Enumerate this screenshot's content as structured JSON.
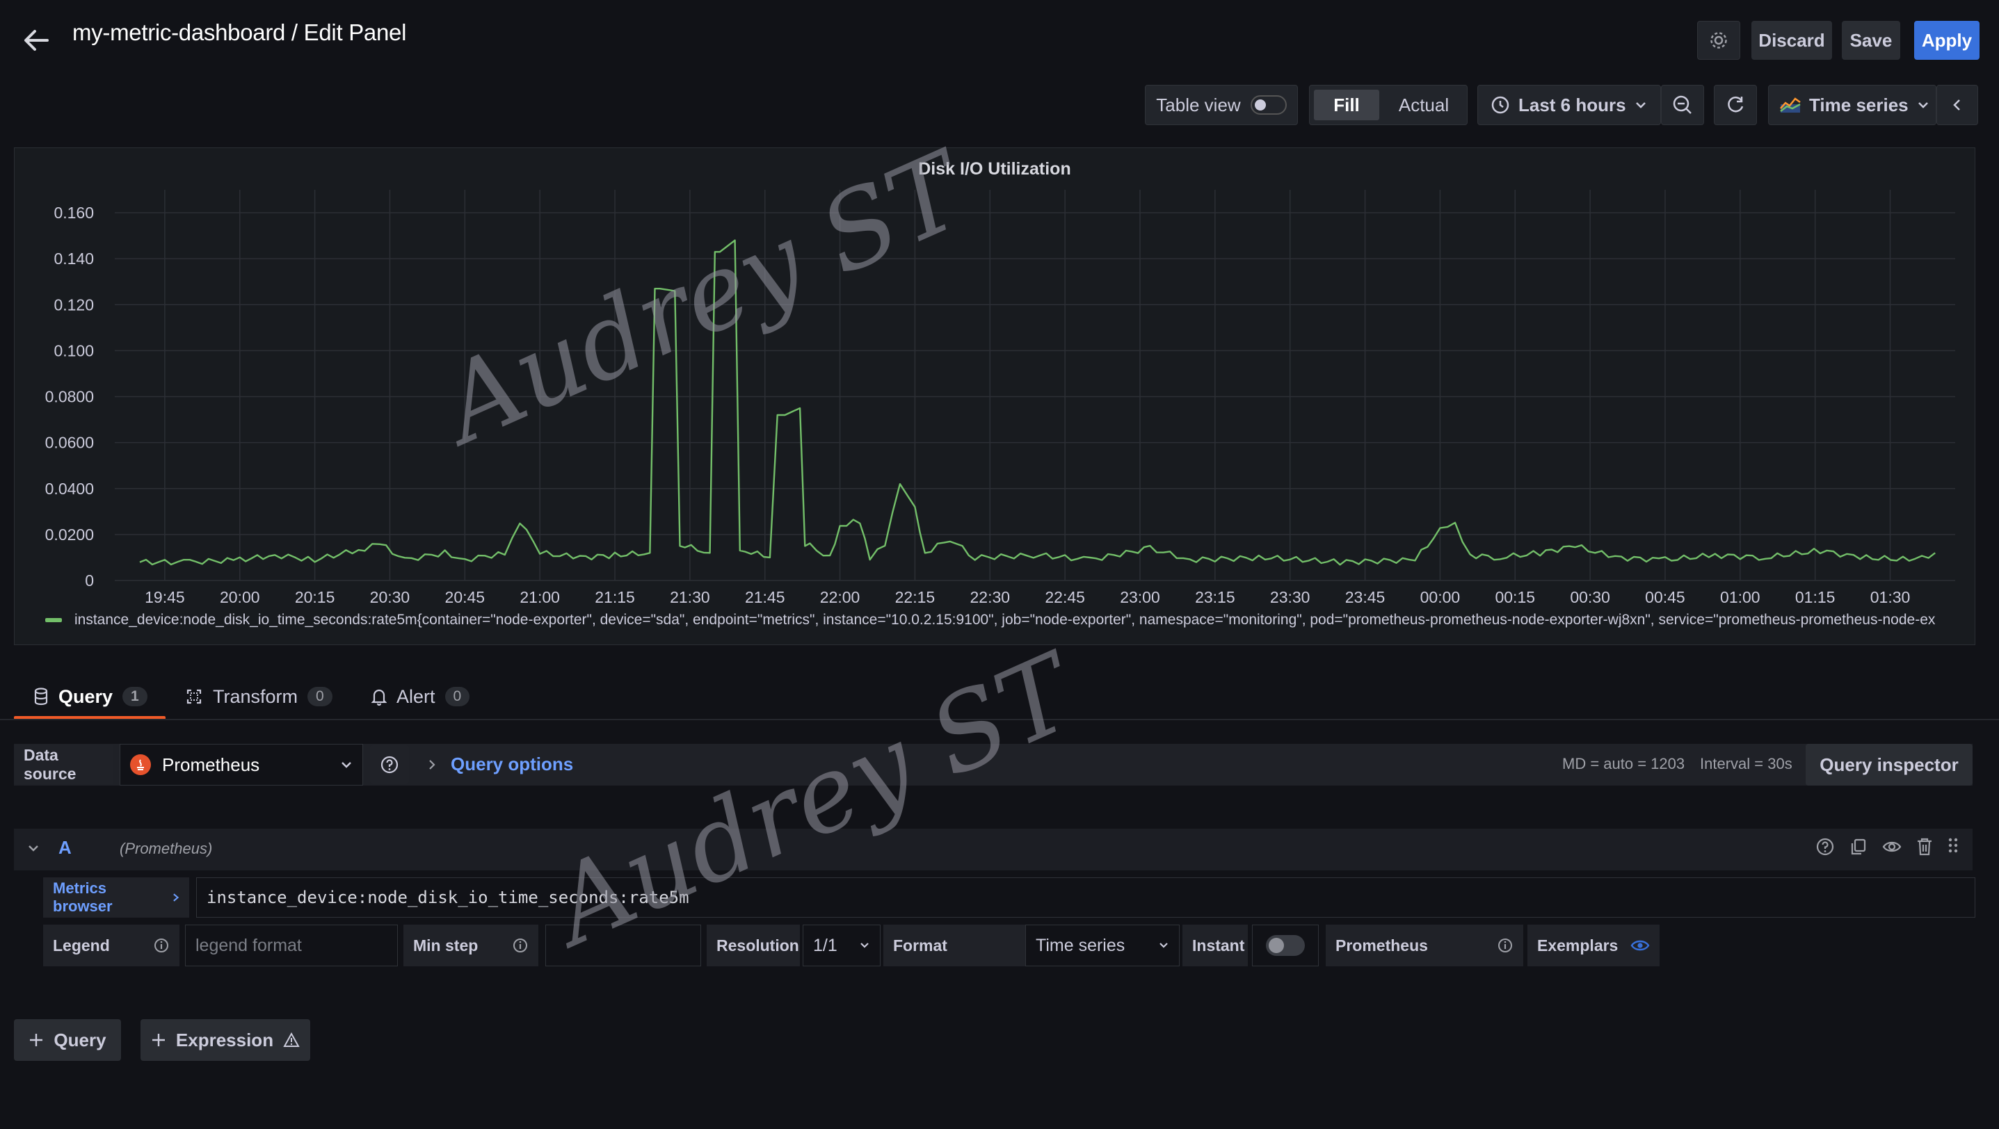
{
  "header": {
    "back_label": "←",
    "title": "my-metric-dashboard / Edit Panel",
    "discard_label": "Discard",
    "save_label": "Save",
    "apply_label": "Apply"
  },
  "toolbar": {
    "table_view_label": "Table view",
    "fill_label": "Fill",
    "actual_label": "Actual",
    "time_range_label": "Last 6 hours",
    "visualization_label": "Time series"
  },
  "panel": {
    "title": "Disk I/O Utilization",
    "legend_text": "instance_device:node_disk_io_time_seconds:rate5m{container=\"node-exporter\", device=\"sda\", endpoint=\"metrics\", instance=\"10.0.2.15:9100\", job=\"node-exporter\", namespace=\"monitoring\", pod=\"prometheus-prometheus-node-exporter-wj8xn\", service=\"prometheus-prometheus-node-ex",
    "series_color": "#73bf69"
  },
  "chart_data": {
    "type": "line",
    "title": "Disk I/O Utilization",
    "xlabel": "",
    "ylabel": "",
    "ylim": [
      0,
      0.17
    ],
    "y_ticks": [
      "0",
      "0.0200",
      "0.0400",
      "0.0600",
      "0.0800",
      "0.100",
      "0.120",
      "0.140",
      "0.160"
    ],
    "x_ticks": [
      "19:45",
      "20:00",
      "20:15",
      "20:30",
      "20:45",
      "21:00",
      "21:15",
      "21:30",
      "21:45",
      "22:00",
      "22:15",
      "22:30",
      "22:45",
      "23:00",
      "23:15",
      "23:30",
      "23:45",
      "00:00",
      "00:15",
      "00:30",
      "00:45",
      "01:00",
      "01:15",
      "01:30"
    ],
    "grid": true,
    "legend_position": "bottom",
    "series": [
      {
        "name": "instance_device:node_disk_io_time_seconds:rate5m",
        "color": "#73bf69",
        "points": [
          [
            "19:40",
            0.008
          ],
          [
            "19:50",
            0.008
          ],
          [
            "20:00",
            0.009
          ],
          [
            "20:07",
            0.011
          ],
          [
            "20:15",
            0.009
          ],
          [
            "20:25",
            0.014
          ],
          [
            "20:28",
            0.016
          ],
          [
            "20:33",
            0.009
          ],
          [
            "20:41",
            0.012
          ],
          [
            "20:45",
            0.009
          ],
          [
            "20:53",
            0.012
          ],
          [
            "20:56",
            0.026
          ],
          [
            "21:00",
            0.012
          ],
          [
            "21:08",
            0.01
          ],
          [
            "21:15",
            0.011
          ],
          [
            "21:22",
            0.012
          ],
          [
            "21:24",
            0.127
          ],
          [
            "21:27",
            0.126
          ],
          [
            "21:29",
            0.015
          ],
          [
            "21:34",
            0.012
          ],
          [
            "21:36",
            0.143
          ],
          [
            "21:39",
            0.148
          ],
          [
            "21:41",
            0.013
          ],
          [
            "21:46",
            0.01
          ],
          [
            "21:49",
            0.072
          ],
          [
            "21:52",
            0.075
          ],
          [
            "21:54",
            0.015
          ],
          [
            "21:58",
            0.01
          ],
          [
            "22:00",
            0.024
          ],
          [
            "22:04",
            0.026
          ],
          [
            "22:06",
            0.01
          ],
          [
            "22:09",
            0.015
          ],
          [
            "22:12",
            0.042
          ],
          [
            "22:15",
            0.032
          ],
          [
            "22:17",
            0.012
          ],
          [
            "22:22",
            0.018
          ],
          [
            "22:27",
            0.01
          ],
          [
            "22:40",
            0.011
          ],
          [
            "22:50",
            0.009
          ],
          [
            "23:02",
            0.014
          ],
          [
            "23:10",
            0.009
          ],
          [
            "23:25",
            0.01
          ],
          [
            "23:40",
            0.008
          ],
          [
            "23:55",
            0.009
          ],
          [
            "00:00",
            0.022
          ],
          [
            "00:03",
            0.024
          ],
          [
            "00:06",
            0.011
          ],
          [
            "00:12",
            0.01
          ],
          [
            "00:20",
            0.012
          ],
          [
            "00:27",
            0.015
          ],
          [
            "00:35",
            0.01
          ],
          [
            "00:45",
            0.009
          ],
          [
            "00:55",
            0.011
          ],
          [
            "01:05",
            0.01
          ],
          [
            "01:16",
            0.013
          ],
          [
            "01:24",
            0.01
          ],
          [
            "01:35",
            0.009
          ],
          [
            "01:39",
            0.012
          ]
        ]
      }
    ]
  },
  "query_tabs": [
    {
      "label": "Query",
      "count": "1"
    },
    {
      "label": "Transform",
      "count": "0"
    },
    {
      "label": "Alert",
      "count": "0"
    }
  ],
  "datasource": {
    "label": "Data source",
    "value": "Prometheus",
    "query_options_label": "Query options",
    "md_text": "MD = auto = 1203",
    "interval_text": "Interval = 30s",
    "inspector_label": "Query inspector"
  },
  "query_a": {
    "ref": "A",
    "datasource_hint": "(Prometheus)",
    "metrics_browser_label": "Metrics browser",
    "expression": "instance_device:node_disk_io_time_seconds:rate5m",
    "legend_label": "Legend",
    "legend_placeholder": "legend format",
    "min_step_label": "Min step",
    "resolution_label": "Resolution",
    "resolution_value": "1/1",
    "format_label": "Format",
    "format_value": "Time series",
    "instant_label": "Instant",
    "type_label": "Prometheus",
    "exemplars_label": "Exemplars"
  },
  "footer": {
    "add_query_label": "Query",
    "add_expression_label": "Expression"
  },
  "watermark_text": "Audrey ST"
}
